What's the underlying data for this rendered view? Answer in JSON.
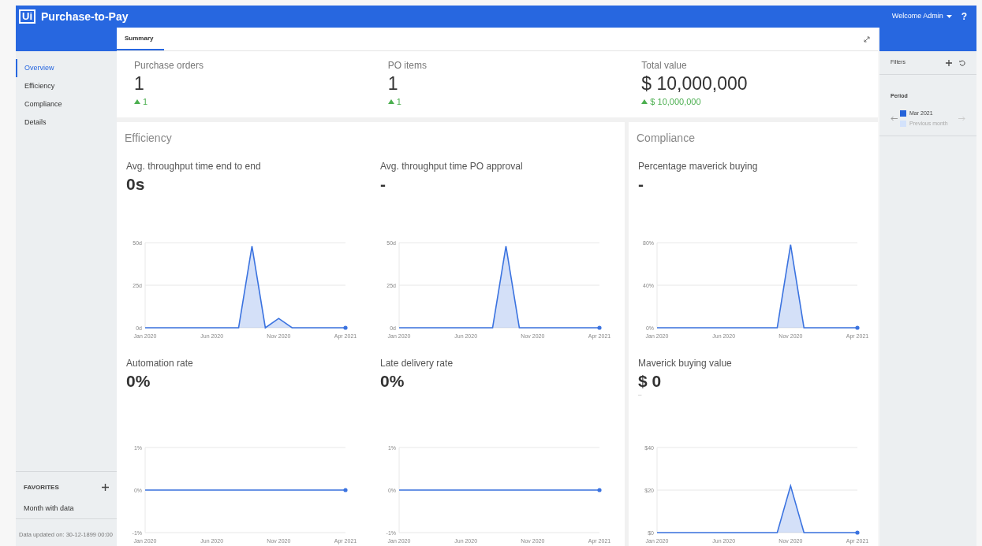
{
  "header": {
    "logo": "Ui",
    "title": "Purchase-to-Pay",
    "user": "Welcome Admin",
    "help": "?"
  },
  "tabs": [
    {
      "label": "Summary",
      "selected": true
    }
  ],
  "sidebar": {
    "items": [
      {
        "label": "Overview",
        "selected": true
      },
      {
        "label": "Efficiency",
        "selected": false
      },
      {
        "label": "Compliance",
        "selected": false
      },
      {
        "label": "Details",
        "selected": false
      }
    ],
    "favorites": {
      "title": "FAVORITES",
      "items": [
        "Month with data"
      ]
    },
    "footer": "Data updated on: 30-12-1899 00:00"
  },
  "kpis": [
    {
      "label": "Purchase orders",
      "value": "1",
      "delta": "1"
    },
    {
      "label": "PO items",
      "value": "1",
      "delta": "1"
    },
    {
      "label": "Total value",
      "value": "$ 10,000,000",
      "delta": "$ 10,000,000"
    }
  ],
  "sections": [
    {
      "title": "Efficiency",
      "metrics": [
        {
          "label": "Avg. throughput time end to end",
          "value": "0s",
          "chart_data": {
            "type": "area",
            "categories": [
              "Jan 2020",
              null,
              null,
              null,
              null,
              "Jun 2020",
              null,
              null,
              null,
              null,
              "Nov 2020",
              null,
              null,
              null,
              null,
              "Apr 2021"
            ],
            "series": [
              {
                "color": "#3b73e0",
                "values": [
                  0,
                  0,
                  0,
                  0,
                  0,
                  0,
                  0,
                  0,
                  48,
                  0,
                  5.5,
                  0,
                  0,
                  0,
                  0,
                  0
                ]
              }
            ],
            "ylim": [
              0,
              50
            ],
            "yticks": [
              {
                "value": 0,
                "label": "0d"
              },
              {
                "value": 25,
                "label": "25d"
              },
              {
                "value": 50,
                "label": "50d"
              }
            ]
          }
        },
        {
          "label": "Avg. throughput time PO approval",
          "value": "-",
          "chart_data": {
            "type": "area",
            "categories": [
              "Jan 2020",
              null,
              null,
              null,
              null,
              "Jun 2020",
              null,
              null,
              null,
              null,
              "Nov 2020",
              null,
              null,
              null,
              null,
              "Apr 2021"
            ],
            "series": [
              {
                "color": "#3b73e0",
                "values": [
                  0,
                  0,
                  0,
                  0,
                  0,
                  0,
                  0,
                  0,
                  48,
                  0,
                  0,
                  0,
                  0,
                  0,
                  0,
                  0
                ]
              }
            ],
            "ylim": [
              0,
              50
            ],
            "yticks": [
              {
                "value": 0,
                "label": "0d"
              },
              {
                "value": 25,
                "label": "25d"
              },
              {
                "value": 50,
                "label": "50d"
              }
            ]
          }
        },
        {
          "label": "Automation rate",
          "value": "0%",
          "chart_data": {
            "type": "line",
            "categories": [
              "Jan 2020",
              null,
              null,
              null,
              null,
              "Jun 2020",
              null,
              null,
              null,
              null,
              "Nov 2020",
              null,
              null,
              null,
              null,
              "Apr 2021"
            ],
            "series": [
              {
                "color": "#3b73e0",
                "values": [
                  0,
                  0,
                  0,
                  0,
                  0,
                  0,
                  0,
                  0,
                  0,
                  0,
                  0,
                  0,
                  0,
                  0,
                  0,
                  0
                ]
              }
            ],
            "ylim": [
              -1,
              1
            ],
            "yticks": [
              {
                "value": -1,
                "label": "-1%"
              },
              {
                "value": 0,
                "label": "0%"
              },
              {
                "value": 1,
                "label": "1%"
              }
            ]
          }
        },
        {
          "label": "Late delivery rate",
          "value": "0%",
          "chart_data": {
            "type": "line",
            "categories": [
              "Jan 2020",
              null,
              null,
              null,
              null,
              "Jun 2020",
              null,
              null,
              null,
              null,
              "Nov 2020",
              null,
              null,
              null,
              null,
              "Apr 2021"
            ],
            "series": [
              {
                "color": "#3b73e0",
                "values": [
                  0,
                  0,
                  0,
                  0,
                  0,
                  0,
                  0,
                  0,
                  0,
                  0,
                  0,
                  0,
                  0,
                  0,
                  0,
                  0
                ]
              }
            ],
            "ylim": [
              -1,
              1
            ],
            "yticks": [
              {
                "value": -1,
                "label": "-1%"
              },
              {
                "value": 0,
                "label": "0%"
              },
              {
                "value": 1,
                "label": "1%"
              }
            ]
          }
        }
      ]
    },
    {
      "title": "Compliance",
      "metrics": [
        {
          "label": "Percentage maverick buying",
          "value": "-",
          "chart_data": {
            "type": "area",
            "categories": [
              "Jan 2020",
              null,
              null,
              null,
              null,
              "Jun 2020",
              null,
              null,
              null,
              null,
              "Nov 2020",
              null,
              null,
              null,
              null,
              "Apr 2021"
            ],
            "series": [
              {
                "color": "#3b73e0",
                "values": [
                  0,
                  0,
                  0,
                  0,
                  0,
                  0,
                  0,
                  0,
                  0,
                  0,
                  78,
                  0,
                  0,
                  0,
                  0,
                  0
                ]
              }
            ],
            "ylim": [
              0,
              80
            ],
            "yticks": [
              {
                "value": 0,
                "label": "0%"
              },
              {
                "value": 40,
                "label": "40%"
              },
              {
                "value": 80,
                "label": "80%"
              }
            ]
          }
        },
        {
          "label": "Maverick buying value",
          "value": "$ 0",
          "note": "–",
          "chart_data": {
            "type": "area",
            "categories": [
              "Jan 2020",
              null,
              null,
              null,
              null,
              "Jun 2020",
              null,
              null,
              null,
              null,
              "Nov 2020",
              null,
              null,
              null,
              null,
              "Apr 2021"
            ],
            "series": [
              {
                "color": "#3b73e0",
                "values": [
                  0,
                  0,
                  0,
                  0,
                  0,
                  0,
                  0,
                  0,
                  0,
                  0,
                  22,
                  0,
                  0,
                  0,
                  0,
                  0
                ]
              }
            ],
            "ylim": [
              0,
              40
            ],
            "yticks": [
              {
                "value": 0,
                "label": "$0"
              },
              {
                "value": 20,
                "label": "$20"
              },
              {
                "value": 40,
                "label": "$40"
              }
            ]
          }
        }
      ]
    }
  ],
  "filters": {
    "title": "Filters",
    "period": {
      "label": "Period",
      "legend": [
        {
          "label": "Mar 2021",
          "color": "#2563d9"
        },
        {
          "label": "Previous month",
          "color": "#d3e2fb"
        }
      ]
    }
  }
}
